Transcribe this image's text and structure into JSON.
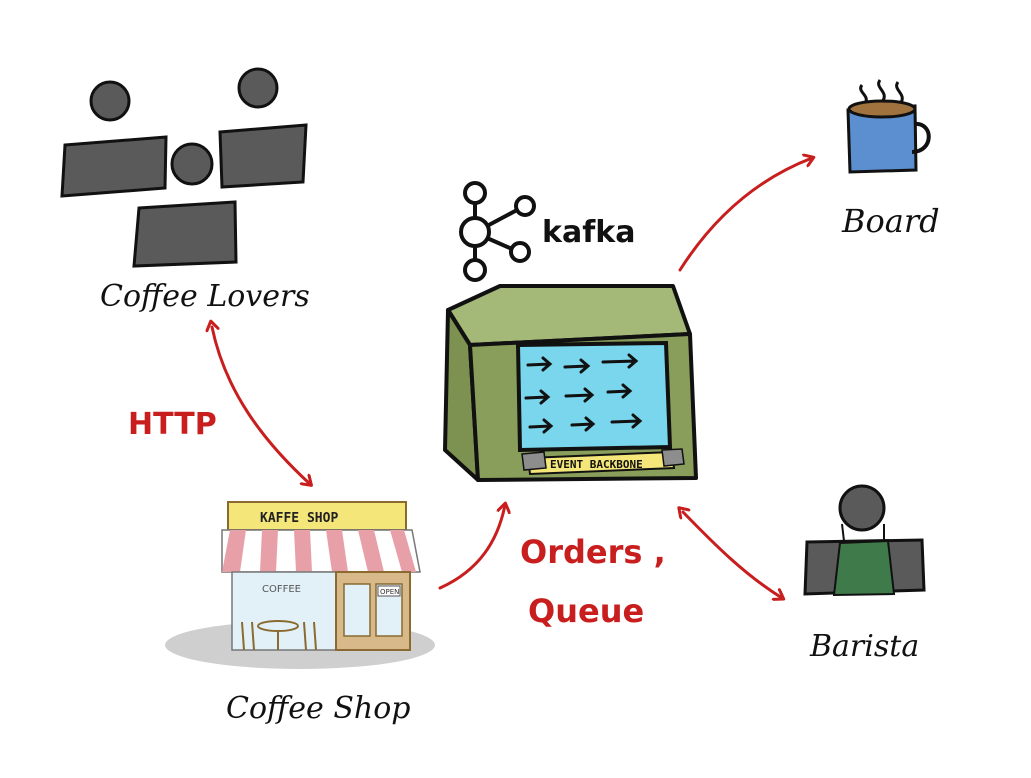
{
  "nodes": {
    "coffee_lovers": {
      "label": "Coffee Lovers"
    },
    "kafka": {
      "logo_text": "kafka",
      "banner": "EVENT BACKBONE"
    },
    "board": {
      "label": "Board"
    },
    "coffee_shop": {
      "label": "Coffee Shop",
      "sign": "KAFFE SHOP",
      "window_text": "COFFEE",
      "door_sign": "OPEN"
    },
    "barista": {
      "label": "Barista"
    }
  },
  "edges": {
    "http": {
      "label": "HTTP"
    },
    "orders": {
      "label_line1": "Orders ,",
      "label_line2": "Queue"
    }
  },
  "colors": {
    "arrow": "#c81e1e",
    "person": "#5a5a5a",
    "machine": "#8a9e5b",
    "screen": "#79d6ec",
    "mug": "#5b8fcf",
    "banner": "#f5e67a",
    "awning": "#e8a0a8"
  },
  "icons": [
    "people-group-icon",
    "kafka-logo-icon",
    "coffee-mug-icon",
    "shop-storefront-icon",
    "barista-icon"
  ]
}
